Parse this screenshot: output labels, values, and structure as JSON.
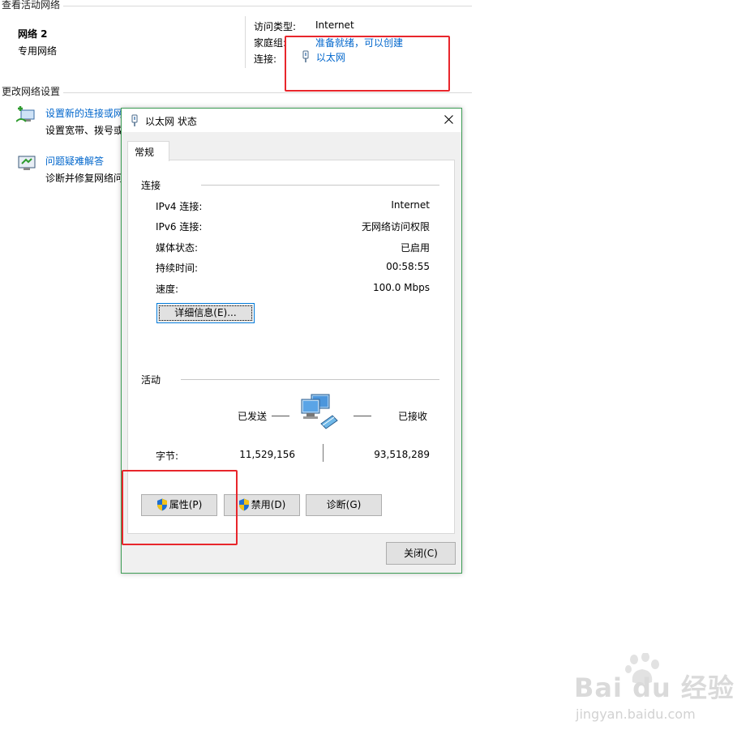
{
  "network_center": {
    "section_active": "查看活动网络",
    "network_name": "网络 2",
    "network_type": "专用网络",
    "access_type_label": "访问类型:",
    "access_type_value": "Internet",
    "homegroup_label": "家庭组:",
    "homegroup_value": "准备就绪，可以创建",
    "connection_label": "连接:",
    "connection_value": "以太网",
    "section_change": "更改网络设置",
    "tasks": [
      {
        "title": "设置新的连接或网",
        "desc": "设置宽带、拨号或"
      },
      {
        "title": "问题疑难解答",
        "desc": "诊断并修复网络问"
      }
    ]
  },
  "dialog": {
    "title": "以太网 状态",
    "tab_general": "常规",
    "group_connection": "连接",
    "rows": [
      {
        "label": "IPv4 连接:",
        "value": "Internet"
      },
      {
        "label": "IPv6 连接:",
        "value": "无网络访问权限"
      },
      {
        "label": "媒体状态:",
        "value": "已启用"
      },
      {
        "label": "持续时间:",
        "value": "00:58:55"
      },
      {
        "label": "速度:",
        "value": "100.0 Mbps"
      }
    ],
    "details_button": "详细信息(E)...",
    "group_activity": "活动",
    "sent_label": "已发送",
    "received_label": "已接收",
    "bytes_label": "字节:",
    "bytes_sent": "11,529,156",
    "bytes_received": "93,518,289",
    "properties_button": "属性(P)",
    "disable_button": "禁用(D)",
    "diagnose_button": "诊断(G)",
    "close_button": "关闭(C)"
  },
  "watermark": {
    "brand": "Bai du 经验",
    "url": "jingyan.baidu.com"
  },
  "colors": {
    "link": "#0066cc",
    "highlight": "#e8262c",
    "dialog_border": "#3d9d55"
  }
}
